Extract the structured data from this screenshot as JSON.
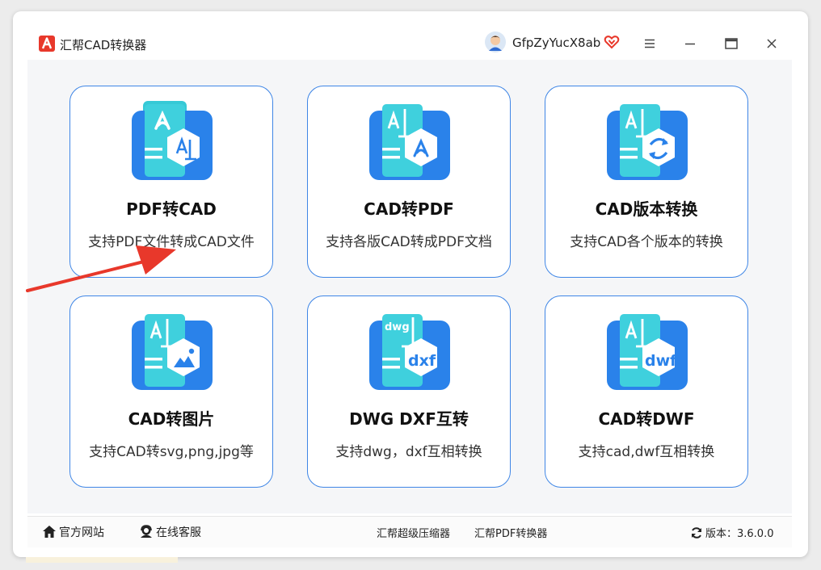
{
  "app": {
    "title": "汇帮CAD转换器",
    "user": "GfpZyYucX8ab",
    "brand_color": "#e8382b",
    "accent_color": "#3f86e6"
  },
  "titlebar": {
    "icons": [
      "app-logo-icon",
      "avatar-icon",
      "vip-heart-icon",
      "menu-icon",
      "minimize-icon",
      "maximize-icon",
      "close-icon"
    ]
  },
  "cards": [
    {
      "title": "PDF转CAD",
      "desc": "支持PDF文件转成CAD文件",
      "icon": "pdf-to-cad-icon"
    },
    {
      "title": "CAD转PDF",
      "desc": "支持各版CAD转成PDF文档",
      "icon": "cad-to-pdf-icon"
    },
    {
      "title": "CAD版本转换",
      "desc": "支持CAD各个版本的转换",
      "icon": "cad-version-icon"
    },
    {
      "title": "CAD转图片",
      "desc": "支持CAD转svg,png,jpg等",
      "icon": "cad-to-image-icon"
    },
    {
      "title": "DWG DXF互转",
      "desc": "支持dwg，dxf互相转换",
      "icon": "dwg-dxf-icon",
      "badge_top": "dwg",
      "badge_bottom": "dxf"
    },
    {
      "title": "CAD转DWF",
      "desc": "支持cad,dwf互相转换",
      "icon": "cad-to-dwf-icon",
      "badge_bottom": "dwf"
    }
  ],
  "footer": {
    "website": "官方网站",
    "service": "在线客服",
    "compressor": "汇帮超级压缩器",
    "pdf_converter": "汇帮PDF转换器",
    "version": "版本：3.6.0.0"
  }
}
